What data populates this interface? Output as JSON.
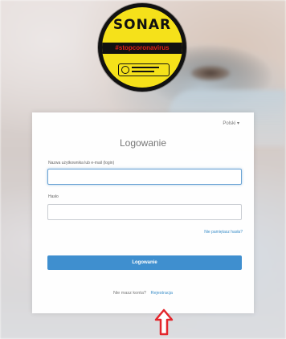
{
  "logo": {
    "title": "SONAR",
    "band": "#stopcoronavirus",
    "colors": {
      "yellow": "#f5e11a",
      "black": "#111111",
      "red": "#e2231a"
    }
  },
  "card": {
    "language": "Polski ▾",
    "title": "Logowanie",
    "username_label": "Nazwa użytkownika lub e-mail (login)",
    "username_value": "",
    "password_label": "Hasło",
    "password_value": "",
    "forgot_link": "Nie pamiętasz hasła?",
    "login_button": "Logowanie",
    "register_prompt": "Nie masz konta?",
    "register_link": "Rejestracja"
  },
  "annotation": {
    "arrow_icon": "up-arrow-icon",
    "arrow_color": "#e3262c"
  },
  "accent_color": "#3f8fcf"
}
